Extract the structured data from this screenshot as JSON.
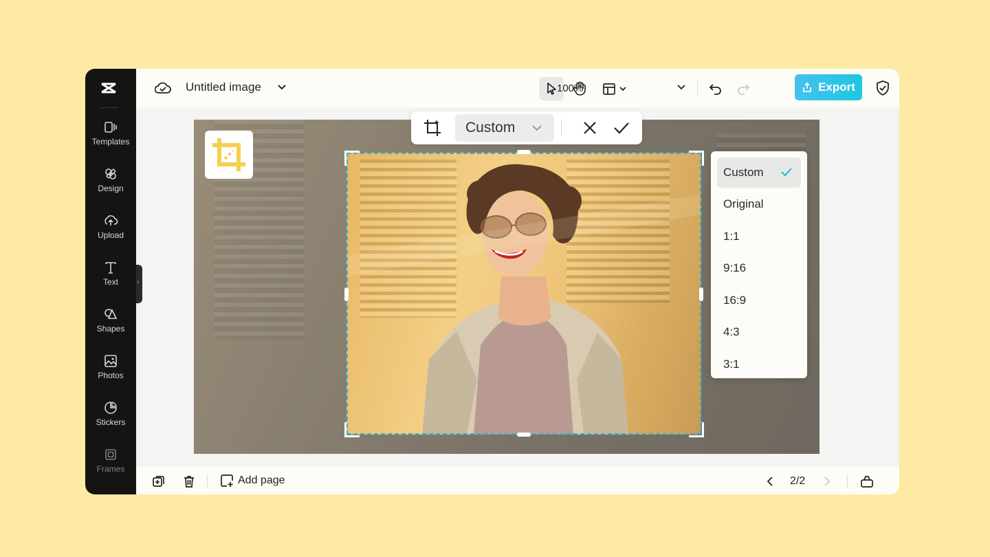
{
  "app": {
    "title": "Untitled image",
    "zoom": "100%",
    "export_label": "Export",
    "accent_color": "#2bb3d6"
  },
  "sidebar": {
    "items": [
      {
        "label": "Templates",
        "icon": "templates-icon"
      },
      {
        "label": "Design",
        "icon": "design-icon"
      },
      {
        "label": "Upload",
        "icon": "upload-icon"
      },
      {
        "label": "Text",
        "icon": "text-icon"
      },
      {
        "label": "Shapes",
        "icon": "shapes-icon"
      },
      {
        "label": "Photos",
        "icon": "photos-icon"
      },
      {
        "label": "Stickers",
        "icon": "stickers-icon"
      },
      {
        "label": "Frames",
        "icon": "frames-icon"
      }
    ]
  },
  "crop_toolbar": {
    "selected_ratio": "Custom"
  },
  "ratio_menu": {
    "options": [
      "Custom",
      "Original",
      "1:1",
      "9:16",
      "16:9",
      "4:3",
      "3:1"
    ],
    "selected": "Custom"
  },
  "bottom": {
    "add_page_label": "Add page",
    "page_indicator": "2/2"
  }
}
